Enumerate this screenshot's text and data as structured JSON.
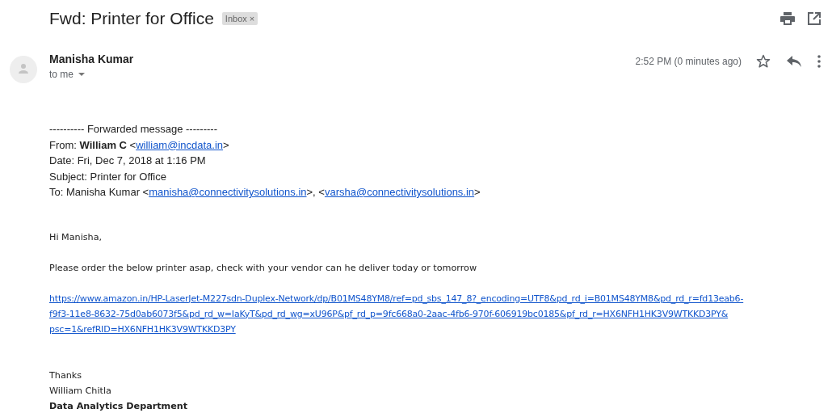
{
  "subject": "Fwd: Printer for Office",
  "labels": [
    {
      "text": "Inbox",
      "close": "×"
    }
  ],
  "sender": {
    "name": "Manisha Kumar",
    "recipient": "to me",
    "time": "2:52 PM (0 minutes ago)",
    "starred": false
  },
  "forwarded": {
    "divider": "---------- Forwarded message ---------",
    "from_parts": [
      {
        "kind": "text",
        "text": "From: "
      },
      {
        "kind": "bold",
        "text": "William C"
      },
      {
        "kind": "text",
        "text": " <"
      },
      {
        "kind": "link",
        "text": "william@incdata.in"
      },
      {
        "kind": "text",
        "text": ">"
      }
    ],
    "date": "Date: Fri, Dec 7, 2018 at 1:16 PM",
    "subject": "Subject: Printer for Office",
    "to_parts": [
      {
        "kind": "text",
        "text": "To: Manisha Kumar <"
      },
      {
        "kind": "link",
        "text": "manisha@connectivitysolutions.in"
      },
      {
        "kind": "text",
        "text": ">, <"
      },
      {
        "kind": "link",
        "text": "varsha@connectivitysolutions.in"
      },
      {
        "kind": "text",
        "text": ">"
      }
    ]
  },
  "body": {
    "greeting": "Hi Manisha,",
    "message": "Please order the below printer asap, check with your vendor can he deliver today or tomorrow",
    "link_lines": [
      "https://www.amazon.in/HP-LaserJet-M227sdn-Duplex-Network/dp/B01MS48YM8/ref=pd_sbs_147_8?_encoding=UTF8&pd_rd_i=B01MS48YM8&pd_rd_r=fd13eab6-",
      "f9f3-11e8-8632-75d0ab6073f5&pd_rd_w=IaKyT&pd_rd_wg=xU96P&pf_rd_p=9fc668a0-2aac-4fb6-970f-606919bc0185&pf_rd_r=HX6NFH1HK3V9WTKKD3PY&",
      "psc=1&refRID=HX6NFH1HK3V9WTKKD3PY"
    ],
    "signature": [
      "Thanks",
      "William Chitla"
    ],
    "department": "Data Analytics Department"
  }
}
